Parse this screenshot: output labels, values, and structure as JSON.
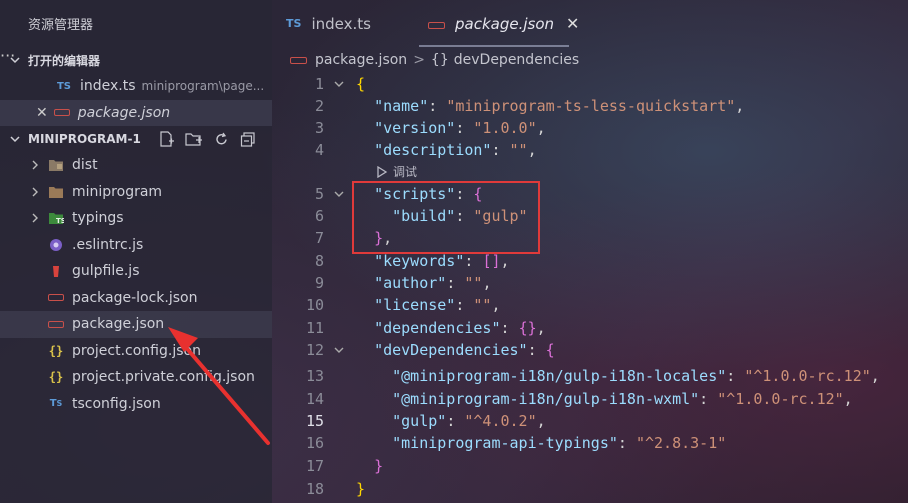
{
  "sidebar": {
    "title": "资源管理器",
    "more": "···",
    "open_editors_header": "打开的编辑器",
    "open_editors": [
      {
        "label": "index.ts",
        "desc": "miniprogram\\page...",
        "icon": "ts-file-icon"
      },
      {
        "label": "package.json",
        "desc": "",
        "icon": "json-file-icon"
      }
    ],
    "project_header": "MINIPROGRAM-1",
    "tree": [
      {
        "label": "dist",
        "type": "folder"
      },
      {
        "label": "miniprogram",
        "type": "folder"
      },
      {
        "label": "typings",
        "type": "folder"
      },
      {
        "label": ".eslintrc.js",
        "type": "eslint"
      },
      {
        "label": "gulpfile.js",
        "type": "gulp"
      },
      {
        "label": "package-lock.json",
        "type": "json"
      },
      {
        "label": "package.json",
        "type": "json"
      },
      {
        "label": "project.config.json",
        "type": "braces"
      },
      {
        "label": "project.private.config.json",
        "type": "braces"
      },
      {
        "label": "tsconfig.json",
        "type": "tsconfig"
      }
    ]
  },
  "tabs": [
    {
      "label": "index.ts",
      "badge": "TS"
    },
    {
      "label": "package.json",
      "close": "✕"
    }
  ],
  "breadcrumb": {
    "file": "package.json",
    "sep": ">",
    "braces": "{}",
    "path": "devDependencies"
  },
  "codelens": "调试",
  "editor": {
    "current_line": 15,
    "lines": [
      {
        "n": "1",
        "t": "{"
      },
      {
        "n": "2",
        "t": "  \"name\": \"miniprogram-ts-less-quickstart\","
      },
      {
        "n": "3",
        "t": "  \"version\": \"1.0.0\","
      },
      {
        "n": "4",
        "t": "  \"description\": \"\","
      },
      {
        "n": "5",
        "t": "  \"scripts\": {"
      },
      {
        "n": "6",
        "t": "    \"build\": \"gulp\""
      },
      {
        "n": "7",
        "t": "  },"
      },
      {
        "n": "8",
        "t": "  \"keywords\": [],"
      },
      {
        "n": "9",
        "t": "  \"author\": \"\","
      },
      {
        "n": "10",
        "t": "  \"license\": \"\","
      },
      {
        "n": "11",
        "t": "  \"dependencies\": {},"
      },
      {
        "n": "12",
        "t": "  \"devDependencies\": {"
      },
      {
        "n": "13",
        "t": "    \"@miniprogram-i18n/gulp-i18n-locales\": \"^1.0.0-rc.12\","
      },
      {
        "n": "14",
        "t": "    \"@miniprogram-i18n/gulp-i18n-wxml\": \"^1.0.0-rc.12\","
      },
      {
        "n": "15",
        "t": "    \"gulp\": \"^4.0.2\","
      },
      {
        "n": "16",
        "t": "    \"miniprogram-api-typings\": \"^2.8.3-1\""
      },
      {
        "n": "17",
        "t": "  }"
      },
      {
        "n": "18",
        "t": "}"
      }
    ]
  },
  "colors": {
    "annotation": "#e03a3a",
    "key": "#9cdcfe",
    "string": "#ce9178",
    "bracket": "#ffd700"
  }
}
